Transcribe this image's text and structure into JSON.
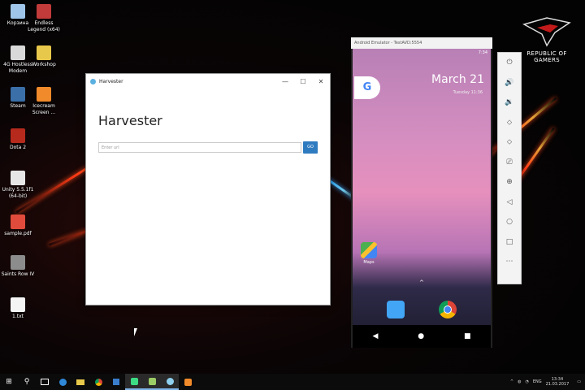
{
  "desktop": {
    "icons": [
      {
        "label": "Корзина"
      },
      {
        "label": "Endless Legend (x64)"
      },
      {
        "label": "4G Hostless Modem"
      },
      {
        "label": "Workshop"
      },
      {
        "label": "Steam"
      },
      {
        "label": "Icecream Screen ..."
      },
      {
        "label": "Dota 2"
      },
      {
        "label": "Unity 5.5.1f1 (64-bit)"
      },
      {
        "label": "sample.pdf"
      },
      {
        "label": "Saints Row IV"
      },
      {
        "label": "1.txt"
      }
    ],
    "branding": {
      "line1": "REPUBLIC OF",
      "line2": "GAMERS"
    }
  },
  "harvester": {
    "window_title": "Harvester",
    "heading": "Harvester",
    "input_placeholder": "Enter url",
    "go_label": "GO",
    "controls": {
      "minimize": "—",
      "maximize": "☐",
      "close": "✕"
    }
  },
  "emulator": {
    "window_title": "Android Emulator - TestAVD:5554",
    "status_time": "7:34",
    "date": "March 21",
    "date_sub": "Tuesday 11:36",
    "google_g": "G",
    "maps_label": "Maps",
    "up_arrow": "^",
    "nav": {
      "back": "◀",
      "home": "●",
      "recents": "■"
    },
    "toolbar": [
      "⏻",
      "🔊",
      "🔉",
      "⬦",
      "⬦",
      "⎚",
      "⊕",
      "◁",
      "○",
      "□",
      "⋯"
    ]
  },
  "taskbar": {
    "start": "⊞",
    "search": "⚲",
    "tray_up": "^",
    "language": "ENG",
    "time": "13:34",
    "date": "21.03.2017"
  },
  "colors": {
    "accent_blue": "#2f7bc0",
    "taskbar": "#0b0b0b"
  }
}
